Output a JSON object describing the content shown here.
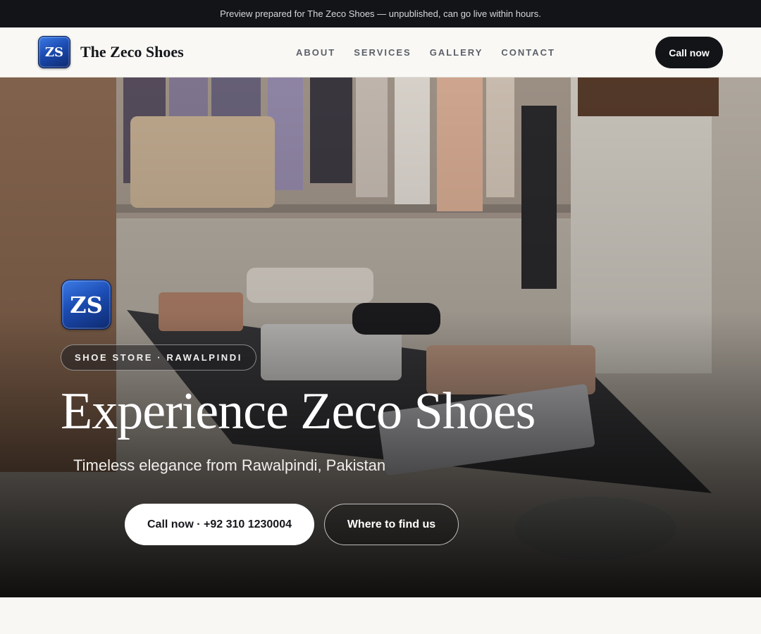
{
  "banner": {
    "text": "Preview prepared for The Zeco Shoes — unpublished, can go live within hours."
  },
  "nav": {
    "logo_text": "ZS",
    "brand_name": "The Zeco Shoes",
    "links": [
      "ABOUT",
      "SERVICES",
      "GALLERY",
      "CONTACT"
    ],
    "cta_label": "Call now"
  },
  "hero": {
    "logo_text": "ZS",
    "badge": "SHOE STORE · RAWALPINDI",
    "headline": "Experience Zeco Shoes",
    "tagline": "Timeless elegance from Rawalpindi, Pakistan",
    "primary_cta": "Call now · +92 310 1230004",
    "secondary_cta": "Where to find us",
    "background_image": "boutique-interior-photo"
  },
  "colors": {
    "dark": "#121418",
    "page_background": "#f8f7f4",
    "logo_blue": "#1b4cb3"
  }
}
